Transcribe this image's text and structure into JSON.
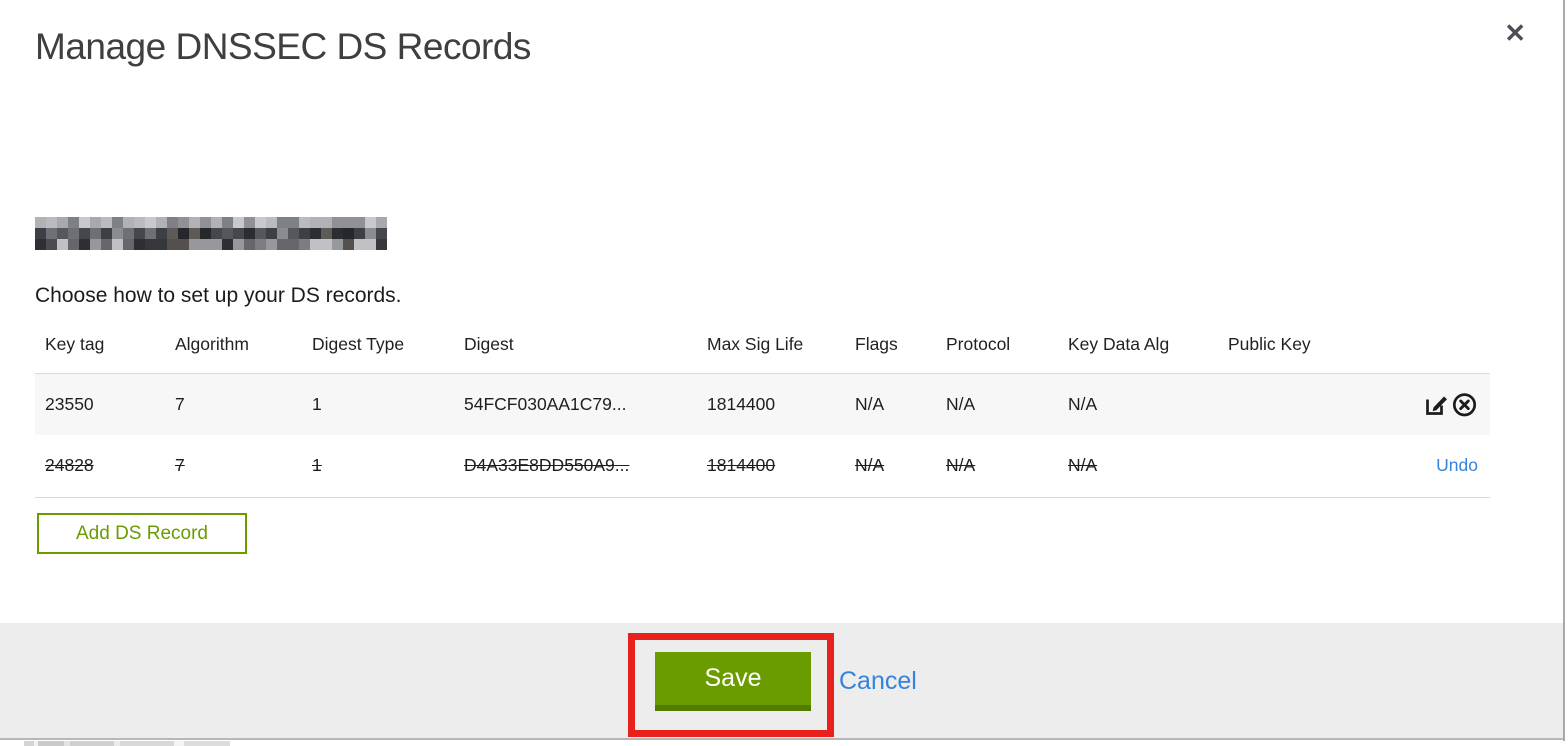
{
  "dialog": {
    "title": "Manage DNSSEC DS Records",
    "close_glyph": "✕",
    "subtitle": "Choose how to set up your DS records.",
    "domain": "[redacted domain name]"
  },
  "table": {
    "headers": [
      "Key tag",
      "Algorithm",
      "Digest Type",
      "Digest",
      "Max Sig Life",
      "Flags",
      "Protocol",
      "Key Data Alg",
      "Public Key"
    ],
    "rows": [
      {
        "key_tag": "23550",
        "algorithm": "7",
        "digest_type": "1",
        "digest": "54FCF030AA1C79...",
        "max_sig_life": "1814400",
        "flags": "N/A",
        "protocol": "N/A",
        "key_data_alg": "N/A",
        "public_key": "",
        "status": "active",
        "actions": [
          "edit",
          "delete"
        ]
      },
      {
        "key_tag": "24828",
        "algorithm": "7",
        "digest_type": "1",
        "digest": "D4A33E8DD550A9...",
        "max_sig_life": "1814400",
        "flags": "N/A",
        "protocol": "N/A",
        "key_data_alg": "N/A",
        "public_key": "",
        "status": "deleted",
        "action_label": "Undo"
      }
    ]
  },
  "buttons": {
    "add_ds_record": "Add DS Record",
    "save": "Save",
    "cancel": "Cancel"
  },
  "colors": {
    "primary_green": "#6a9c00",
    "green_border_dark": "#537b02",
    "link_blue": "#3583db",
    "annotation_red": "#e8211d",
    "footer_bg": "#ededee",
    "row_alt_bg": "#f7f7f8"
  }
}
